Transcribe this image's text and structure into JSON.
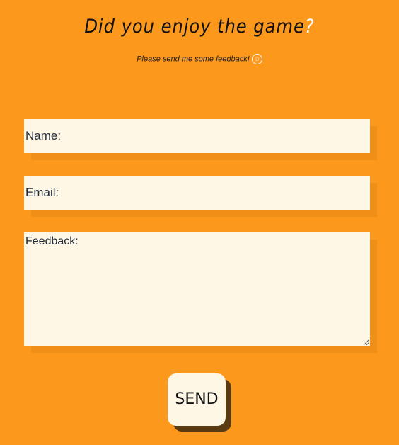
{
  "header": {
    "title": "Did you enjoy the game",
    "title_mark": "?",
    "subtitle": "Please send me some feedback!",
    "smile_icon": "☺"
  },
  "form": {
    "name_label": "Name:",
    "email_label": "Email:",
    "feedback_label": "Feedback:",
    "send_label": "SEND"
  },
  "colors": {
    "background": "#fc981c",
    "field": "#fff7e6"
  }
}
